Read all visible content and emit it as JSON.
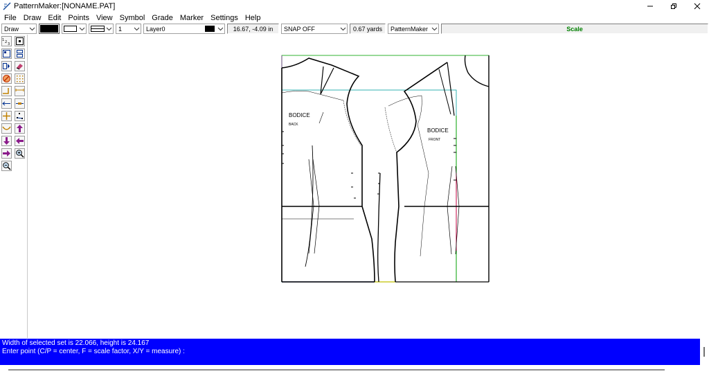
{
  "window": {
    "title": "PatternMaker:[NONAME.PAT]",
    "minimize_icon": "minimize-icon",
    "maximize_icon": "restore-icon",
    "close_icon": "close-icon"
  },
  "menu": [
    "File",
    "Draw",
    "Edit",
    "Points",
    "View",
    "Symbol",
    "Grade",
    "Marker",
    "Settings",
    "Help"
  ],
  "toolbar": {
    "mode": "Draw",
    "line_width": "1",
    "layer": "Layer0",
    "coordinates": "16.67, -4.09 in",
    "snap": "SNAP OFF",
    "yardage": "0.67 yards",
    "style": "PatternMaker",
    "scale_label": "Scale",
    "scale_color": "#008000",
    "fill_color": "#000000",
    "layer_color": "#000000"
  },
  "palette": {
    "tools": [
      "text-123-icon",
      "point-icon",
      "select-box-icon",
      "split-box-icon",
      "mirror-icon",
      "eraser-icon",
      "no-symbol-icon",
      "dotted-grid-icon",
      "corner-line-icon",
      "measure-line-icon",
      "perpendicular-icon",
      "double-arrow-icon",
      "add-point-icon",
      "points-icon",
      "curve-icon",
      "arrow-up-icon",
      "arrow-down-icon",
      "arrow-left-icon",
      "arrow-right-icon",
      "zoom-in-icon",
      "zoom-out-icon"
    ]
  },
  "canvas": {
    "labels": [
      {
        "text": "BODICE",
        "piece": "back"
      },
      {
        "text": "BACK",
        "piece": "back"
      },
      {
        "text": "BODICE",
        "piece": "front"
      },
      {
        "text": "FRONT",
        "piece": "front"
      }
    ]
  },
  "status": {
    "line1": "Width of selected set is 22.066, height is 24.167",
    "line2": "Enter point (C/P = center, F = scale factor, X/Y = measure) :",
    "background": "#0000ff"
  }
}
